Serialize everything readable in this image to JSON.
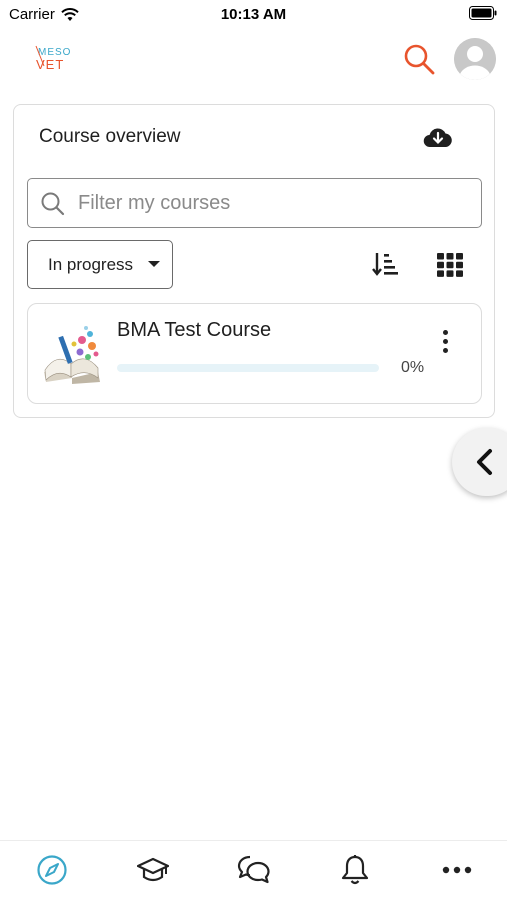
{
  "status_bar": {
    "carrier": "Carrier",
    "time": "10:13 AM"
  },
  "header": {
    "logo_top": "MESO",
    "logo_bottom": "VET",
    "accent_color": "#e8542d"
  },
  "overview": {
    "title": "Course overview",
    "filter": {
      "placeholder": "Filter my courses",
      "value": ""
    },
    "status_select": {
      "selected": "In progress"
    },
    "courses": [
      {
        "name": "BMA Test Course",
        "progress_label": "0%",
        "progress_value": 0
      }
    ]
  },
  "tabbar": {
    "active_color": "#3aa7c9",
    "items": [
      "compass-icon",
      "graduation-cap-icon",
      "chat-bubbles-icon",
      "bell-icon",
      "more-icon"
    ]
  }
}
